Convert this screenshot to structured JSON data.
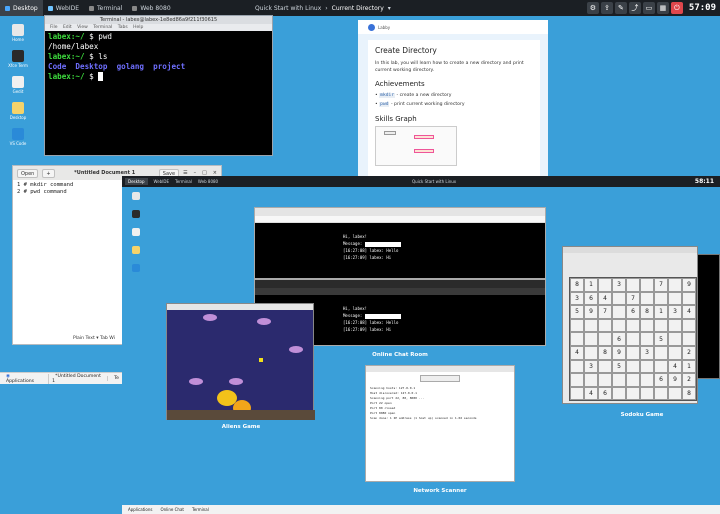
{
  "topbar": {
    "tabs": [
      "Desktop",
      "WebIDE",
      "Terminal",
      "Web 8080"
    ],
    "center_left": "Quick Start with Linux",
    "center_right": "Current Directory",
    "clock": "57:09"
  },
  "desktop_icons": [
    "Home",
    "Xfce Term",
    "Gedit",
    "Desktop",
    "VS Code"
  ],
  "terminal": {
    "title": "Terminal - labex@labex-1e8ed86a9f211f30615",
    "menu": [
      "File",
      "Edit",
      "View",
      "Terminal",
      "Tabs",
      "Help"
    ],
    "lines": [
      {
        "prompt": "labex:~/",
        "cmd": " $ pwd"
      },
      {
        "out": "/home/labex"
      },
      {
        "prompt": "labex:~/",
        "cmd": " $ ls"
      },
      {
        "dirs": "Code  Desktop  golang  project"
      },
      {
        "prompt": "labex:~/",
        "cmd": " $ "
      }
    ]
  },
  "lab": {
    "brand": "Labby",
    "title": "Create Directory",
    "intro": "In this lab, you will learn how to create a new directory and print current working directory.",
    "ach_title": "Achievements",
    "ach": [
      {
        "code": "mkdir",
        "text": " - create a new directory"
      },
      {
        "code": "pwd",
        "text": " - print current working directory"
      }
    ],
    "skills_title": "Skills Graph"
  },
  "gedit": {
    "open": "Open",
    "title": "*Untitled Document 1",
    "save": "Save",
    "lines": [
      "# mkdir command",
      "# pwd command"
    ],
    "status": "Plain Text ▾    Tab Wi"
  },
  "taskbar": [
    "Applications",
    "*Untitled Document 1",
    "Te"
  ],
  "overview": {
    "tabs": [
      "Desktop",
      "WebIDE",
      "Terminal",
      "Web 8080"
    ],
    "center": "Quick Start with Linux",
    "clock": "58:11",
    "chat_label": "Online Chat Room",
    "aliens_label": "Aliens Game",
    "scanner_label": "Network Scanner",
    "sudoku_label": "Sodoku Game",
    "chat_lines": [
      "Hi, labex!",
      "Message:",
      "[16:27:08] labex: Hello",
      "[16:27:09] labex: Hi"
    ],
    "scanner_lines": [
      "Scanning hosts: 127.0.0.1",
      "Host discovered: 127.0.0.1",
      "Scanning port 22, 80, 8080 ...",
      "Port 22 open",
      "Port 80 closed",
      "Port 8080 open",
      "Scan done: 1 IP address (1 host up) scanned in 1.02 seconds"
    ],
    "bottom": [
      "Applications",
      "Online Chat",
      "Terminal"
    ]
  },
  "sudoku": {
    "cells": [
      "8",
      "1",
      "",
      "3",
      "",
      "",
      "7",
      "",
      "9",
      "3",
      "6",
      "4",
      "",
      "7",
      "",
      "",
      "",
      "",
      "5",
      "9",
      "7",
      "",
      "6",
      "8",
      "1",
      "3",
      "4",
      "",
      "",
      "",
      "",
      "",
      "",
      "",
      "",
      "",
      "",
      "",
      "",
      "6",
      "",
      "",
      "5",
      "",
      "",
      "4",
      "",
      "8",
      "9",
      "",
      "3",
      "",
      "",
      "2",
      "",
      "3",
      "",
      "5",
      "",
      "",
      "",
      "4",
      "1",
      "",
      "",
      "",
      "",
      "",
      "",
      "6",
      "9",
      "2",
      "",
      "4",
      "6",
      "",
      "",
      "",
      "",
      "",
      "8"
    ]
  },
  "colors": {
    "desktop": "#3a9fd9",
    "terminal_green": "#3ddc3d",
    "terminal_blue": "#6f6fff"
  }
}
